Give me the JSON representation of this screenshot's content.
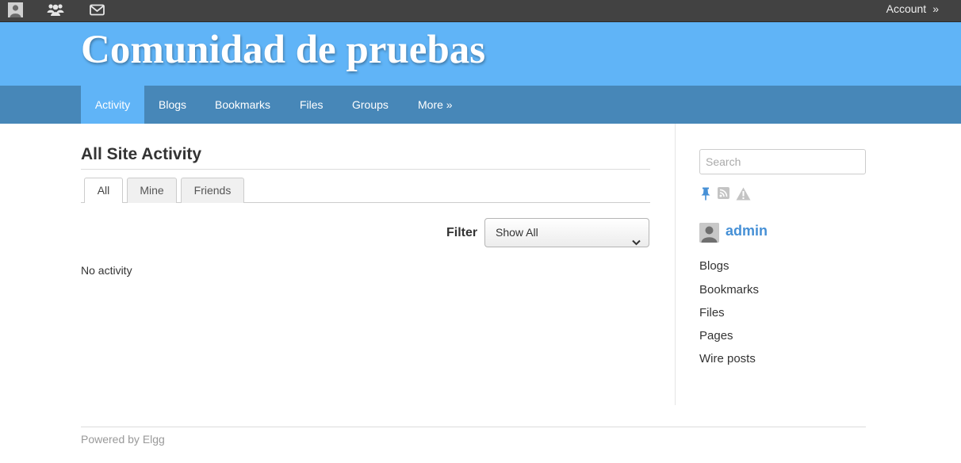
{
  "topbar": {
    "icons": [
      "avatar-icon",
      "friends-icon",
      "messages-icon"
    ],
    "account_label": "Account",
    "account_suffix": "»"
  },
  "header": {
    "site_title": "Comunidad de pruebas",
    "background": "#60b4f7"
  },
  "nav": {
    "items": [
      {
        "label": "Activity",
        "active": true
      },
      {
        "label": "Blogs"
      },
      {
        "label": "Bookmarks"
      },
      {
        "label": "Files"
      },
      {
        "label": "Groups"
      },
      {
        "label": "More »"
      }
    ],
    "background": "#4787b8"
  },
  "main": {
    "title": "All Site Activity",
    "tabs": [
      {
        "label": "All",
        "active": true
      },
      {
        "label": "Mine"
      },
      {
        "label": "Friends"
      }
    ],
    "filter": {
      "label": "Filter",
      "selected": "Show All"
    },
    "empty_message": "No activity"
  },
  "sidebar": {
    "search_placeholder": "Search",
    "icons": [
      "pin-icon",
      "rss-icon",
      "report-icon"
    ],
    "owner": {
      "name": "admin"
    },
    "links": [
      "Blogs",
      "Bookmarks",
      "Files",
      "Pages",
      "Wire posts"
    ],
    "link_color": "#4690d6"
  },
  "footer": {
    "text": "Powered by Elgg"
  }
}
